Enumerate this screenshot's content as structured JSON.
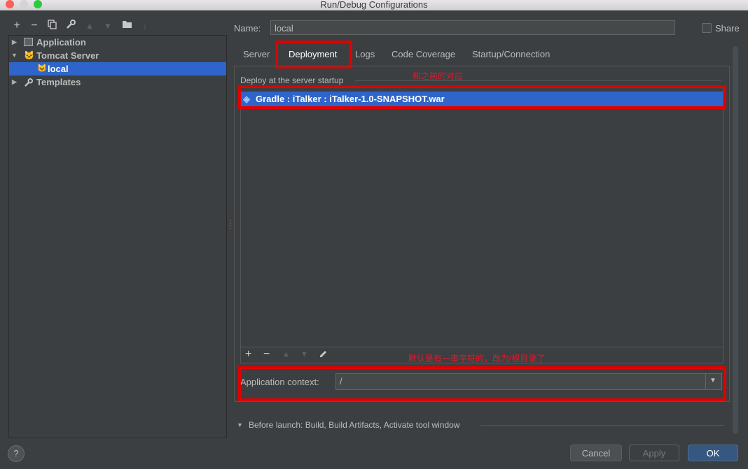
{
  "window": {
    "title": "Run/Debug Configurations"
  },
  "toolbar": {
    "icons": [
      "add-icon",
      "remove-icon",
      "copy-icon",
      "wrench-icon",
      "move-up-icon",
      "move-down-icon",
      "folder-icon",
      "sort-icon"
    ]
  },
  "tree": {
    "items": [
      {
        "label": "Application",
        "icon": "application-icon"
      },
      {
        "label": "Tomcat Server",
        "icon": "tomcat-icon"
      },
      {
        "label": "local",
        "icon": "tomcat-config-icon"
      },
      {
        "label": "Templates",
        "icon": "wrench-icon"
      }
    ]
  },
  "form": {
    "name_label": "Name:",
    "name_value": "local",
    "share_label": "Share"
  },
  "tabs": [
    "Server",
    "Deployment",
    "Logs",
    "Code Coverage",
    "Startup/Connection"
  ],
  "deployment": {
    "section_label": "Deploy at the server startup",
    "items": [
      "Gradle : iTalker : iTalker-1.0-SNAPSHOT.war"
    ],
    "annotation_top": "和之前的对应",
    "annotation_bottom": "默认是有一串字符的，改为/根目录了",
    "context_label": "Application context:",
    "context_value": "/"
  },
  "before_launch": "Before launch: Build, Build Artifacts, Activate tool window",
  "buttons": {
    "help": "?",
    "cancel": "Cancel",
    "apply": "Apply",
    "ok": "OK"
  },
  "colors": {
    "selection": "#2f65ca",
    "annotation": "#e00000",
    "ok_button": "#365880"
  }
}
